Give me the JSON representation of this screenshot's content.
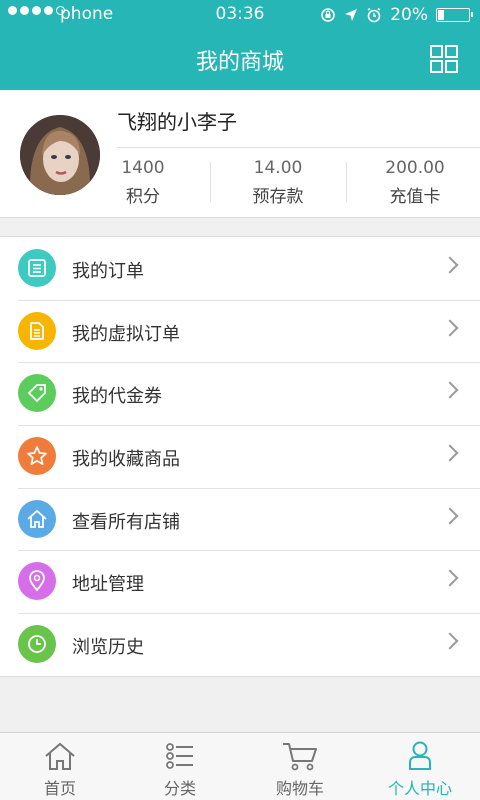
{
  "status_bar": {
    "carrier": "phone",
    "time": "03:36",
    "battery_percent_text": "20%",
    "battery_level": 0.2
  },
  "header": {
    "title": "我的商城"
  },
  "profile": {
    "username": "飞翔的小李子",
    "stats": [
      {
        "value": "1400",
        "label": "积分"
      },
      {
        "value": "14.00",
        "label": "预存款"
      },
      {
        "value": "200.00",
        "label": "充值卡"
      }
    ]
  },
  "menu": {
    "items": [
      {
        "label": "我的订单",
        "icon": "order-icon",
        "color": "#3ec9c1"
      },
      {
        "label": "我的虚拟订单",
        "icon": "virtual-order-icon",
        "color": "#f7b500"
      },
      {
        "label": "我的代金券",
        "icon": "voucher-tag-icon",
        "color": "#5ccc5c"
      },
      {
        "label": "我的收藏商品",
        "icon": "star-icon",
        "color": "#f07c3c"
      },
      {
        "label": "查看所有店铺",
        "icon": "store-home-icon",
        "color": "#5aaae6"
      },
      {
        "label": "地址管理",
        "icon": "location-pin-icon",
        "color": "#d56ee8"
      },
      {
        "label": "浏览历史",
        "icon": "clock-icon",
        "color": "#68c44a"
      }
    ]
  },
  "tabbar": {
    "tabs": [
      {
        "label": "首页",
        "icon": "home-icon"
      },
      {
        "label": "分类",
        "icon": "category-list-icon"
      },
      {
        "label": "购物车",
        "icon": "cart-icon"
      },
      {
        "label": "个人中心",
        "icon": "person-icon",
        "active": true
      }
    ]
  },
  "colors": {
    "accent": "#25b6b5"
  }
}
